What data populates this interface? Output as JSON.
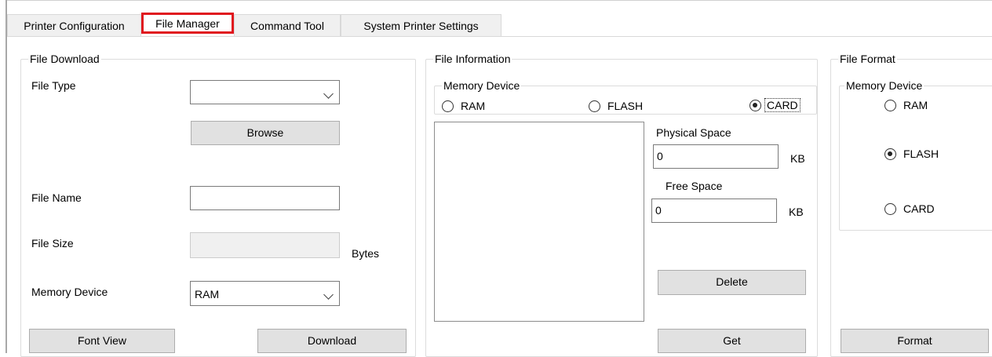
{
  "tabs": [
    {
      "label": "Printer Configuration",
      "active": false
    },
    {
      "label": "File Manager",
      "active": true
    },
    {
      "label": "Command Tool",
      "active": false
    },
    {
      "label": "System Printer Settings",
      "active": false
    }
  ],
  "file_download": {
    "title": "File Download",
    "file_type_label": "File Type",
    "file_type_value": "",
    "browse_label": "Browse",
    "file_name_label": "File Name",
    "file_name_value": "",
    "file_size_label": "File Size",
    "file_size_value": "",
    "bytes_unit": "Bytes",
    "memory_device_label": "Memory Device",
    "memory_device_value": "RAM",
    "font_view_label": "Font View",
    "download_label": "Download"
  },
  "file_information": {
    "title": "File Information",
    "memory_device_group": "Memory Device",
    "radio_ram": "RAM",
    "radio_flash": "FLASH",
    "radio_card": "CARD",
    "selected": "CARD",
    "physical_space_label": "Physical Space",
    "physical_space_value": "0",
    "free_space_label": "Free Space",
    "free_space_value": "0",
    "kb_unit": "KB",
    "delete_label": "Delete",
    "get_label": "Get"
  },
  "file_format": {
    "title": "File Format",
    "memory_device_group": "Memory Device",
    "radio_ram": "RAM",
    "radio_flash": "FLASH",
    "radio_card": "CARD",
    "selected": "FLASH",
    "format_label": "Format"
  },
  "colors": {
    "highlight": "#e0161e",
    "button": "#e1e1e1",
    "tab": "#f0f0f0"
  }
}
